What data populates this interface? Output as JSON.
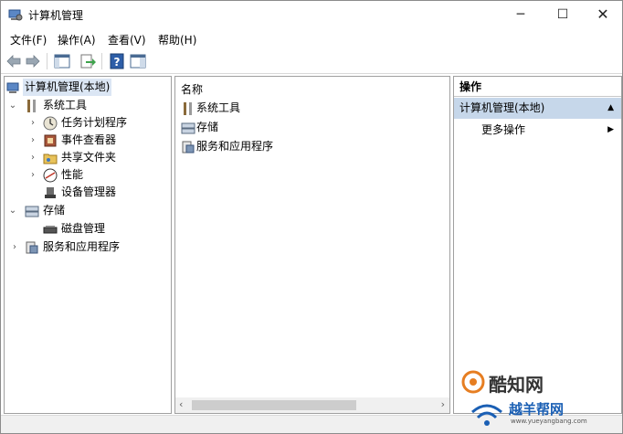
{
  "window": {
    "title": "计算机管理",
    "controls": {
      "minimize": "─",
      "maximize": "☐",
      "close": "✕"
    }
  },
  "menu": {
    "file": "文件(F)",
    "action": "操作(A)",
    "view": "查看(V)",
    "help": "帮助(H)"
  },
  "toolbar": {
    "icons": [
      "back-icon",
      "forward-icon",
      "show-tree-icon",
      "export-icon",
      "help-icon",
      "show-action-pane-icon"
    ]
  },
  "tree": {
    "root": "计算机管理(本地)",
    "system_tools": "系统工具",
    "task_scheduler": "任务计划程序",
    "event_viewer": "事件查看器",
    "shared_folders": "共享文件夹",
    "performance": "性能",
    "device_manager": "设备管理器",
    "storage": "存储",
    "disk_management": "磁盘管理",
    "services": "服务和应用程序"
  },
  "list": {
    "column_name": "名称",
    "items": [
      "系统工具",
      "存储",
      "服务和应用程序"
    ]
  },
  "actions": {
    "header": "操作",
    "section": "计算机管理(本地)",
    "more": "更多操作"
  },
  "watermark": {
    "line1": "酷知网",
    "line2": "越羊帮网",
    "line3": "www.yueyangbang.com"
  },
  "colors": {
    "selection": "#dbe6f4",
    "action_section": "#c6d7ea",
    "border": "#a0a0a0"
  }
}
